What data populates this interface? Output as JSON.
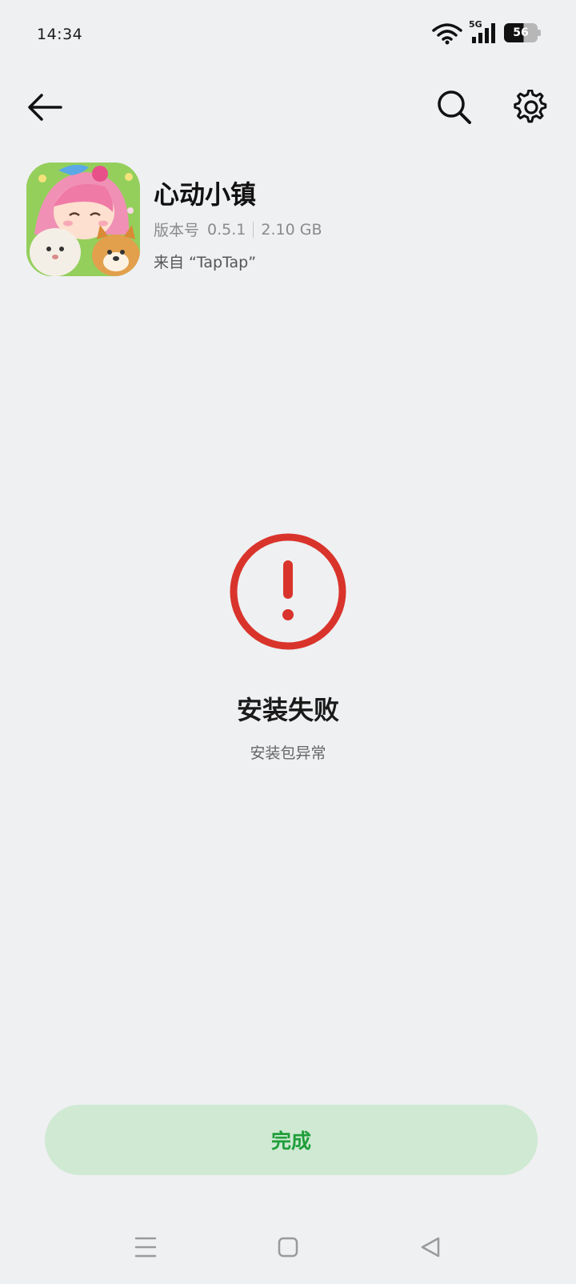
{
  "status_bar": {
    "time": "14:34",
    "network_label": "5G",
    "battery_level": "56",
    "icons": [
      "wifi-icon",
      "signal-icon",
      "battery-icon"
    ]
  },
  "toolbar": {
    "icons": [
      "back-arrow-icon",
      "search-icon",
      "gear-icon"
    ]
  },
  "app": {
    "name": "心动小镇",
    "version_label": "版本号",
    "version": "0.5.1",
    "size": "2.10 GB",
    "source": "来自 “TapTap”"
  },
  "result": {
    "icon": "error-icon",
    "title": "安装失败",
    "subtitle": "安装包异常"
  },
  "actions": {
    "done_label": "完成"
  },
  "nav_bar": {
    "icons": [
      "menu-icon",
      "home-icon",
      "back-icon"
    ]
  },
  "colors": {
    "background": "#eff0f2",
    "error": "#d9342b",
    "button_bg": "#cfe9d3",
    "button_text": "#1f9e3a"
  }
}
